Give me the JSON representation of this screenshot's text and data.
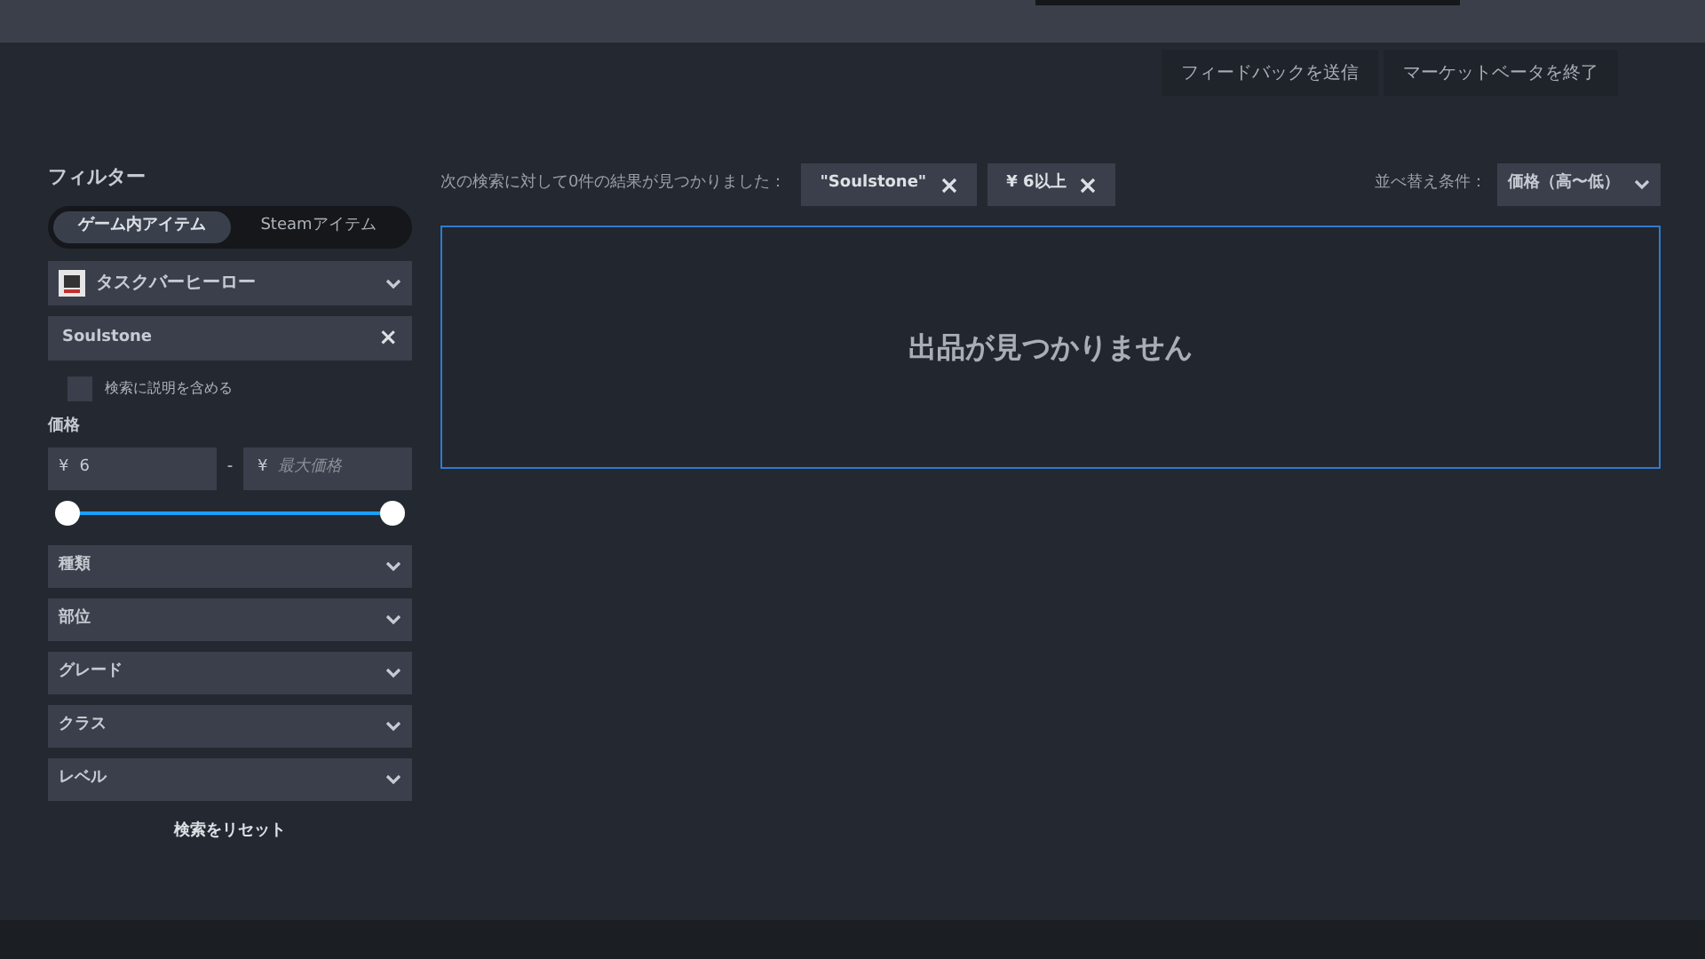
{
  "header_buttons": [
    "フィードバックを送信",
    "マーケットベータを終了"
  ],
  "filter": {
    "title": "フィルター",
    "tabs": [
      {
        "label": "ゲーム内アイテム",
        "selected": true
      },
      {
        "label": "Steamアイテム",
        "selected": false
      }
    ],
    "game": {
      "label": "タスクバーヒーロー"
    },
    "search": {
      "value": "Soulstone",
      "clear": "×"
    },
    "include_description": {
      "label": "検索に説明を含める",
      "checked": false
    },
    "price": {
      "label": "価格",
      "min": {
        "currency": "¥",
        "value": "6"
      },
      "separator": "-",
      "max": {
        "currency": "¥",
        "placeholder": "最大価格"
      },
      "thumbs": [
        {
          "level": 0
        },
        {
          "level": 1
        }
      ]
    },
    "dropdowns": [
      "種類",
      "部位",
      "グレード",
      "クラス",
      "レベル"
    ],
    "reset": "検索をリセット"
  },
  "results": {
    "summary": "次の検索に対して0件の結果が見つかりました：",
    "chips": [
      "\"Soulstone\"",
      "¥ 6以上"
    ],
    "sort_label": "並べ替え条件：",
    "sort_value": "価格（高〜低）",
    "empty": "出品が見つかりません"
  }
}
